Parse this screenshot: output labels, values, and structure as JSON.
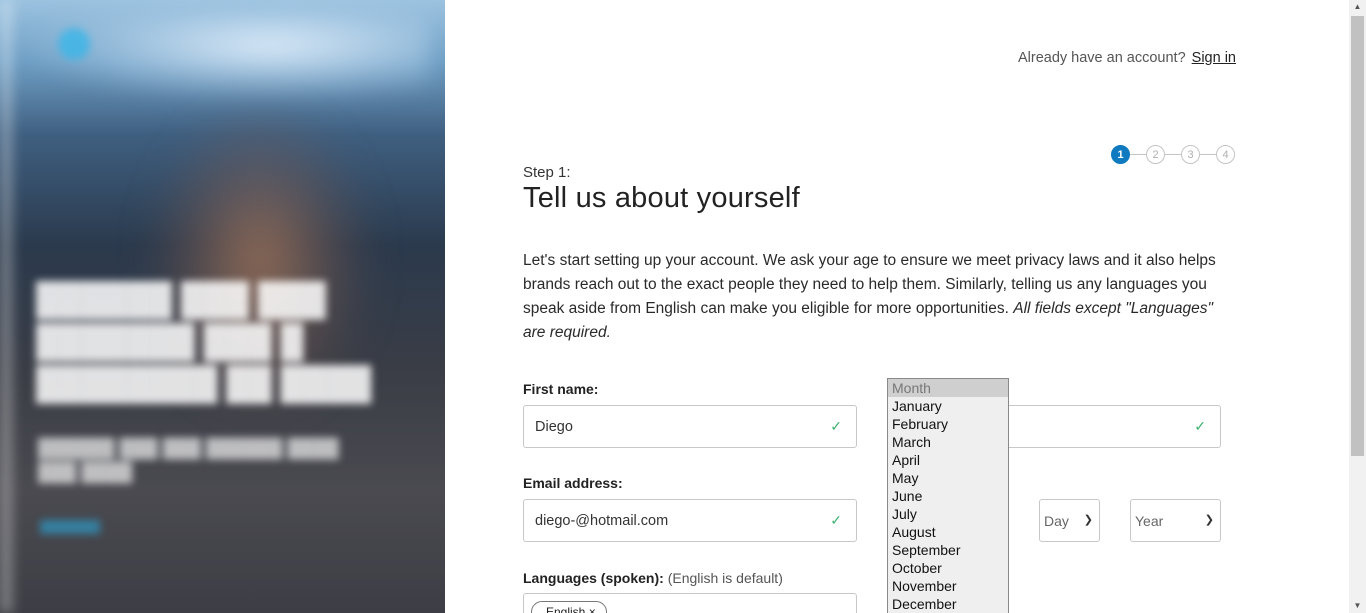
{
  "header": {
    "already_text": "Already have an account?",
    "signin_label": "Sign in"
  },
  "stepper": {
    "steps": [
      "1",
      "2",
      "3",
      "4"
    ],
    "active_step": 1
  },
  "form": {
    "step_label": "Step 1:",
    "title": "Tell us about yourself",
    "intro_text": "Let's start setting up your account. We ask your age to ensure we meet privacy laws and it also helps brands reach out to the exact people they need to help them. Similarly, telling us any languages you speak aside from English can make you eligible for more opportunities. ",
    "intro_emphasis": "All fields except \"Languages\" are required.",
    "first_name_label": "First name:",
    "first_name_value": "Diego",
    "email_label": "Email address:",
    "email_value": "diego-@hotmail.com",
    "day_placeholder": "Day",
    "year_placeholder": "Year",
    "languages_label": "Languages (spoken):",
    "languages_hint": "(English is default)",
    "language_tag": "English ×"
  },
  "month_dropdown": {
    "header": "Month",
    "options": [
      "January",
      "February",
      "March",
      "April",
      "May",
      "June",
      "July",
      "August",
      "September",
      "October",
      "November",
      "December"
    ]
  },
  "colors": {
    "accent": "#0f7ac0",
    "valid": "#3cb371"
  },
  "icons": {
    "valid": "check-icon",
    "select": "chevron-down-icon"
  }
}
